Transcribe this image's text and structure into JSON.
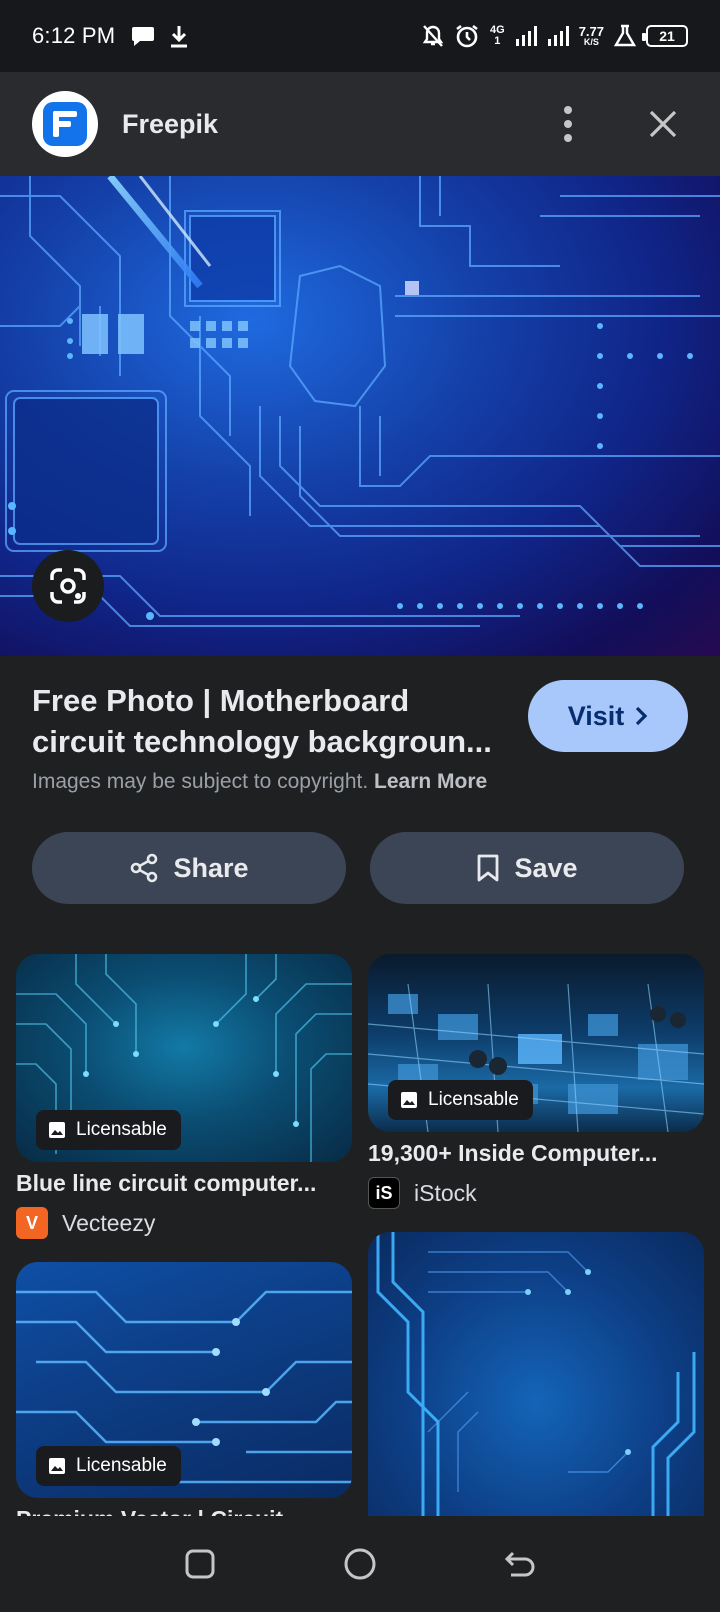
{
  "status_bar": {
    "time": "6:12 PM",
    "network_type": "4G",
    "network_sub": "1",
    "speed_value": "7.77",
    "speed_unit": "K/S",
    "battery": "21"
  },
  "header": {
    "site_name": "Freepik"
  },
  "result": {
    "title": "Free Photo | Motherboard circuit technology backgroun...",
    "visit_label": "Visit",
    "copyright_text": "Images may be subject to copyright.",
    "learn_more": "Learn More",
    "share_label": "Share",
    "save_label": "Save"
  },
  "related": [
    {
      "title": "Blue line circuit computer...",
      "source": "Vecteezy",
      "badge": "Licensable"
    },
    {
      "title": "19,300+ Inside Computer...",
      "source": "iStock",
      "badge": "Licensable"
    },
    {
      "title": "Premium Vector | Circuit...",
      "source": "",
      "badge": "Licensable"
    },
    {
      "title": "",
      "source": "",
      "badge": ""
    }
  ],
  "icons": {
    "chat": "chat-bubble-icon",
    "download": "download-icon",
    "mute": "bell-off-icon",
    "alarm": "alarm-icon",
    "signal": "signal-icon",
    "lab": "flask-icon",
    "menu": "more-vert-icon",
    "close": "close-icon",
    "lens": "google-lens-icon",
    "share": "share-icon",
    "save": "bookmark-icon",
    "image": "image-icon",
    "nav_recent": "square-icon",
    "nav_home": "circle-icon",
    "nav_back": "back-icon"
  },
  "colors": {
    "visit_button": "#a8c7fa",
    "action_button": "#3c4555",
    "background": "#1f2022",
    "vecteezy": "#f26522"
  }
}
